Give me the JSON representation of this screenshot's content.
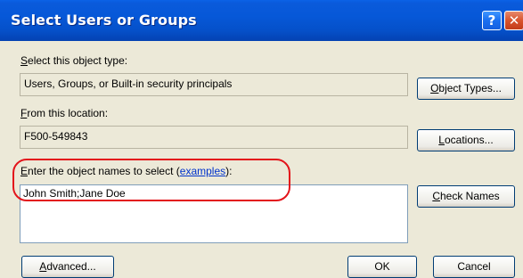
{
  "window": {
    "title": "Select Users or Groups",
    "help_glyph": "?",
    "close_glyph": "✕"
  },
  "object_type": {
    "label_first": "S",
    "label_rest": "elect this object type:",
    "value": "Users, Groups, or Built-in security principals",
    "button_first": "O",
    "button_rest": "bject Types..."
  },
  "location": {
    "label_first": "F",
    "label_rest": "rom this location:",
    "value": "F500-549843",
    "button_first": "L",
    "button_rest": "ocations..."
  },
  "names": {
    "label_first": "E",
    "label_rest": "nter the object names to select (",
    "link": "examples",
    "label_end": "):",
    "value": "John Smith;Jane Doe",
    "check_first": "C",
    "check_rest": "heck Names"
  },
  "footer": {
    "advanced_first": "A",
    "advanced_rest": "dvanced...",
    "ok": "OK",
    "cancel": "Cancel"
  },
  "colors": {
    "titlebar": "#0658d8",
    "highlight": "#e3141b",
    "dialog_bg": "#ece9d8",
    "link": "#0033cc"
  }
}
